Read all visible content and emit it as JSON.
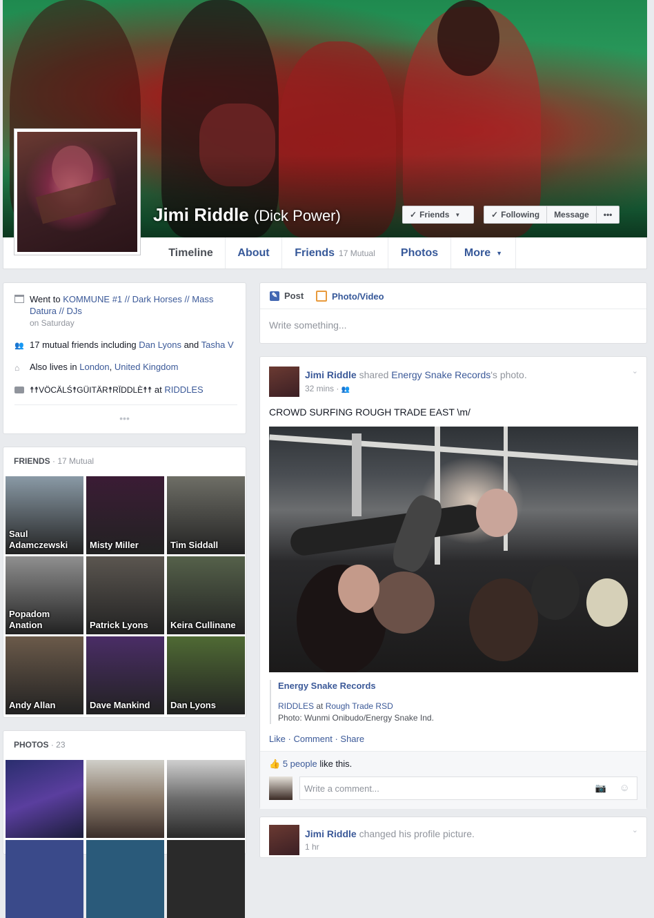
{
  "colors": {
    "link": "#365899",
    "bg": "#e9ebee",
    "card_border": "#dddfe2",
    "muted": "#90949c"
  },
  "profile": {
    "name": "Jimi Riddle",
    "alt_name": "(Dick Power)"
  },
  "cover_buttons": {
    "friends": "Friends",
    "following": "Following",
    "message": "Message",
    "more": "•••"
  },
  "tabs": [
    {
      "label": "Timeline"
    },
    {
      "label": "About"
    },
    {
      "label": "Friends",
      "sub": "17 Mutual"
    },
    {
      "label": "Photos"
    },
    {
      "label": "More"
    }
  ],
  "intro": {
    "went_prefix": "Went to",
    "went_event": "KOMMUNE #1 // Dark Horses // Mass Datura // DJs",
    "went_when": "on Saturday",
    "mutual_prefix": "17 mutual friends including",
    "mutual_friend_1": "Dan Lyons",
    "mutual_and": "and",
    "mutual_friend_2": "Tasha V",
    "lives_prefix": "Also lives in",
    "lives_city": "London",
    "lives_country": "United Kingdom",
    "lives_sep": ",",
    "work_role": "☨☨VÖCÄLŚ☨GÜITÄR☨RÏDDLÈ☨☨",
    "work_at": "at",
    "work_place": "RIDDLES",
    "see_more": "•••"
  },
  "friends_section": {
    "title": "FRIENDS",
    "count": "· 17 Mutual",
    "friends": [
      {
        "name": "Saul Adamczewski",
        "color": "#8a9aa6"
      },
      {
        "name": "Misty Miller",
        "color": "#3b1c35"
      },
      {
        "name": "Tim Siddall",
        "color": "#6e6e66"
      },
      {
        "name": "Popadom Anation",
        "color": "#8f8f8f"
      },
      {
        "name": "Patrick Lyons",
        "color": "#5b5650"
      },
      {
        "name": "Keira Cullinane",
        "color": "#55614a"
      },
      {
        "name": "Andy Allan",
        "color": "#6b5a4a"
      },
      {
        "name": "Dave Mankind",
        "color": "#4a2d66"
      },
      {
        "name": "Dan Lyons",
        "color": "#4f6a34"
      }
    ]
  },
  "photos_section": {
    "title": "PHOTOS",
    "count": "· 23"
  },
  "composer": {
    "post": "Post",
    "photo_video": "Photo/Video",
    "placeholder": "Write something..."
  },
  "post1": {
    "author": "Jimi Riddle",
    "action_1": "shared",
    "page": "Energy Snake Records",
    "action_2": "'s photo.",
    "time": "32 mins",
    "time_sep": "·",
    "text": "CROWD SURFING ROUGH TRADE EAST \\m/",
    "attribution_title": "Energy Snake Records",
    "attr_line1_a": "RIDDLES",
    "attr_line1_at": "at",
    "attr_line1_b": "Rough Trade RSD",
    "attr_line2": "Photo: Wunmi Onibudo/Energy Snake Ind.",
    "like": "Like",
    "comment": "Comment",
    "share": "Share",
    "sep": "·",
    "likes_count": "5 people",
    "likes_suffix": "like this.",
    "comment_placeholder": "Write a comment..."
  },
  "post2": {
    "author": "Jimi Riddle",
    "action": "changed his profile picture.",
    "time": "1 hr"
  }
}
